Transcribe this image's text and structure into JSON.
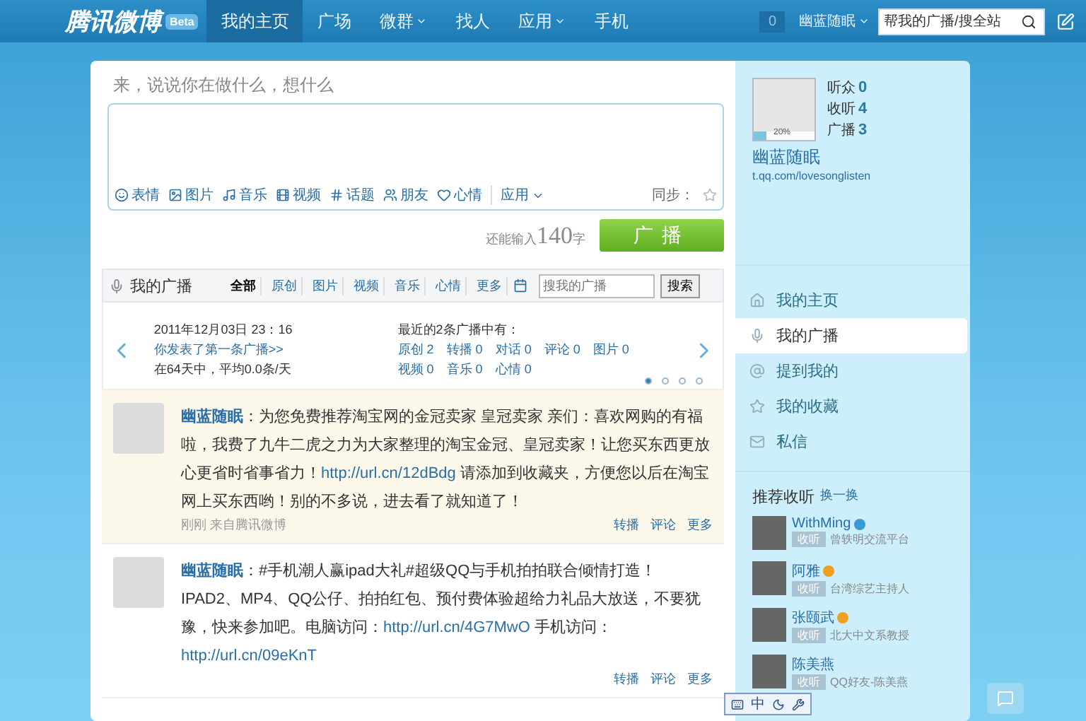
{
  "topbar": {
    "logo": "腾讯微博",
    "logo_badge": "Beta",
    "nav": [
      {
        "label": "我的主页",
        "selected": true,
        "dropdown": false
      },
      {
        "label": "广场",
        "selected": false,
        "dropdown": false
      },
      {
        "label": "微群",
        "selected": false,
        "dropdown": true
      },
      {
        "label": "找人",
        "selected": false,
        "dropdown": false
      },
      {
        "label": "应用",
        "selected": false,
        "dropdown": true
      },
      {
        "label": "手机",
        "selected": false,
        "dropdown": false
      }
    ],
    "notify_count": "0",
    "user": "幽蓝随眠",
    "search_placeholder": "帮我的广播/搜全站"
  },
  "compose": {
    "prompt": "来，说说你在做什么，想什么",
    "tools": [
      {
        "kind": "emoji",
        "label": "表情"
      },
      {
        "kind": "image",
        "label": "图片"
      },
      {
        "kind": "music",
        "label": "音乐"
      },
      {
        "kind": "video",
        "label": "视频"
      },
      {
        "kind": "topic",
        "label": "话题"
      },
      {
        "kind": "friend",
        "label": "朋友"
      },
      {
        "kind": "mood",
        "label": "心情"
      },
      {
        "kind": "app",
        "label": "应用"
      }
    ],
    "sync_label": "同步：",
    "counter_prefix": "还能输入",
    "counter": "140",
    "counter_suffix": "字",
    "submit": "广播"
  },
  "my_broadcasts": {
    "title": "我的广播",
    "filters": [
      {
        "label": "全部",
        "selected": true
      },
      {
        "label": "原创",
        "selected": false
      },
      {
        "label": "图片",
        "selected": false
      },
      {
        "label": "视频",
        "selected": false
      },
      {
        "label": "音乐",
        "selected": false
      },
      {
        "label": "心情",
        "selected": false
      },
      {
        "label": "更多",
        "selected": false
      }
    ],
    "search_placeholder": "搜我的广播",
    "search_button": "搜索",
    "summary": {
      "date": "2011年12月03日 23：16",
      "first_link": "你发表了第一条广播>>",
      "average": "在64天中，平均0.0条/天",
      "recent_heading": "最近的2条广播中有：",
      "counts": [
        {
          "label": "原创",
          "value": "2"
        },
        {
          "label": "转播",
          "value": "0"
        },
        {
          "label": "对话",
          "value": "0"
        },
        {
          "label": "评论",
          "value": "0"
        },
        {
          "label": "图片",
          "value": "0"
        },
        {
          "label": "视频",
          "value": "0"
        },
        {
          "label": "音乐",
          "value": "0"
        },
        {
          "label": "心情",
          "value": "0"
        }
      ]
    },
    "pager": [
      {
        "selected": true
      },
      {
        "selected": false
      },
      {
        "selected": false
      },
      {
        "selected": false
      }
    ]
  },
  "posts": [
    {
      "author": "幽蓝随眠",
      "author_sep": "：",
      "highlighted": true,
      "parts": [
        {
          "kind": "text",
          "text": "为您免费推荐淘宝网的金冠卖家 皇冠卖家 亲们：喜欢网购的有福啦，我费了九牛二虎之力为大家整理的淘宝金冠、皇冠卖家！让您买东西更放心更省时省事省力！"
        },
        {
          "kind": "link",
          "text": "http://url.cn/12dBdg"
        },
        {
          "kind": "text",
          "text": " 请添加到收藏夹，方便您以后在淘宝网上买东西哟！别的不多说，进去看了就知道了！"
        }
      ],
      "meta": "刚刚 来自腾讯微博",
      "actions": [
        "转播",
        "评论",
        "更多"
      ]
    },
    {
      "author": "幽蓝随眠",
      "author_sep": "：",
      "highlighted": false,
      "parts": [
        {
          "kind": "text",
          "text": "#手机潮人赢ipad大礼#超级QQ与手机拍拍联合倾情打造！IPAD2、MP4、QQ公仔、拍拍红包、预付费体验超给力礼品大放送，不要犹豫，快来参加吧。电脑访问："
        },
        {
          "kind": "link",
          "text": "http://url.cn/4G7MwO"
        },
        {
          "kind": "text",
          "text": " 手机访问："
        },
        {
          "kind": "link",
          "text": "http://url.cn/09eKnT"
        }
      ],
      "actions": [
        "转播",
        "评论",
        "更多"
      ]
    }
  ],
  "profile": {
    "progress": {
      "level": 0.2,
      "label": "20%"
    },
    "stats": [
      {
        "label": "听众",
        "value": "0"
      },
      {
        "label": "收听",
        "value": "4"
      },
      {
        "label": "广播",
        "value": "3"
      }
    ],
    "name": "幽蓝随眠",
    "url": "t.qq.com/lovesonglisten"
  },
  "sidebar_nav": [
    {
      "kind": "home",
      "label": "我的主页",
      "selected": false
    },
    {
      "kind": "mic",
      "label": "我的广播",
      "selected": true
    },
    {
      "kind": "at",
      "label": "提到我的",
      "selected": false
    },
    {
      "kind": "star",
      "label": "我的收藏",
      "selected": false
    },
    {
      "kind": "mail",
      "label": "私信",
      "selected": false
    }
  ],
  "recommend": {
    "title": "推荐收听",
    "refresh": "换一换",
    "users": [
      {
        "name": "WithMing",
        "color": "#3a9ad9",
        "follow": "收听",
        "desc": "曾轶明交流平台"
      },
      {
        "name": "阿雅",
        "color": "#f0a020",
        "follow": "收听",
        "desc": "台湾综艺主持人"
      },
      {
        "name": "张颐武",
        "color": "#f0a020",
        "follow": "收听",
        "desc": "北大中文系教授"
      },
      {
        "name": "陈美燕",
        "follow": "收听",
        "desc": "QQ好友-陈美燕"
      }
    ]
  },
  "ime": {
    "mode": "中"
  }
}
